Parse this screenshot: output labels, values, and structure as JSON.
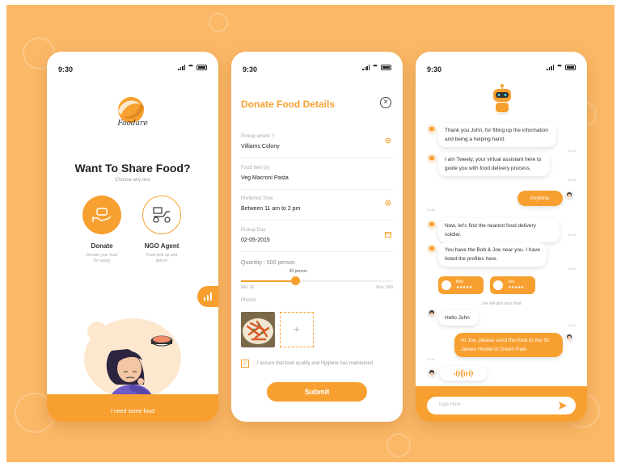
{
  "colors": {
    "accent": "#f7a030",
    "background": "#fbb867"
  },
  "status": {
    "time": "9:30"
  },
  "screen1": {
    "brand": "Foodare",
    "heading": "Want To Share Food?",
    "subheading": "Choose any one",
    "donate": {
      "label": "Donate",
      "desc_line1": "Donate your food",
      "desc_line2": "for needy"
    },
    "ngo": {
      "label": "NGO Agent",
      "desc_line1": "Food pick up and",
      "desc_line2": "deliver"
    },
    "bottom_label": "I need some food"
  },
  "screen2": {
    "title": "Donate Food Details",
    "fields": [
      {
        "label": "Pickup where ?",
        "value": "Villiams Colony",
        "icon": "location-icon"
      },
      {
        "label": "Food Item (s)",
        "value": "Veg Macroni Pasta",
        "icon": ""
      },
      {
        "label": "Preferred Time",
        "value": "Between 11 am to 2 pm",
        "icon": "location-icon"
      },
      {
        "label": "Pickup Day",
        "value": "02-05-2015",
        "icon": "calendar-icon"
      }
    ],
    "quantity": {
      "label": "Quantity : 500 person",
      "value_label": "30 person",
      "min": "Min: 20",
      "max": "Max: 500",
      "fraction": 0.36
    },
    "photos_label": "Photos",
    "add_photo": "+",
    "assurance": "I assure that food quality and Hygiene has maintained.",
    "submit": "Submit"
  },
  "screen3": {
    "messages": [
      {
        "line1": "Thank you John, for filling up the information",
        "line2": "and being a helping hand.",
        "time": "10:36"
      },
      {
        "line1": "I am Tweety, your virtual assistant here to",
        "line2": "guide you with food delivery process.",
        "time": "10:36"
      },
      {
        "line1": "Anytime.",
        "time": "10:36"
      },
      {
        "line1": "Now, let's find the nearest food delivery soldier.",
        "time": "10:39"
      },
      {
        "line1": "You have the Bob & Joe near you. I have",
        "line2": "listed the profiles here.",
        "time": "10:40"
      },
      {
        "line1": "Hello John",
        "time": "10:41"
      },
      {
        "line1": "Hi Joe, please send the food to the St.",
        "line2": "James Hostel in Green Park",
        "time": "10:41"
      }
    ],
    "agents": [
      {
        "name": "Bob",
        "stars": "★★★★★"
      },
      {
        "name": "Joe",
        "stars": "★★★★★"
      }
    ],
    "pick_note": "Joe will pick your food",
    "input_placeholder": "Type Here"
  }
}
